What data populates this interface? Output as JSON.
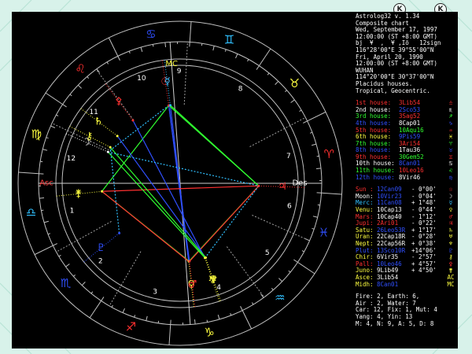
{
  "window": {
    "toolbar_icons": [
      {
        "name": "k-icon",
        "glyph": "K"
      },
      {
        "name": "k-icon",
        "glyph": "K"
      }
    ]
  },
  "info": {
    "lines": [
      "Astrolog32 v. 1.34",
      "Composite chart",
      "Wed, September 17, 1997",
      "12:00:00 (ST +8:00 GMT)",
      "bj  ¥  ,  ¥ ,Iô   12sign",
      "116°28'00\"E 39°55'00\"N",
      "Fri, April 20, 1990",
      "12:00:00 (ST +8:00 GMT)",
      "WUHAN",
      "114°20'00\"E 30°37'00\"N",
      "Placidus houses.",
      "Tropical, Geocentric."
    ]
  },
  "houses": [
    {
      "label": "1st house:",
      "value": "3Lib54",
      "glyph": "♎",
      "label_color": "#ff3030",
      "value_color": "#ff3030",
      "glyph_color": "#ff3030"
    },
    {
      "label": "2nd house:",
      "value": "2Sco53",
      "glyph": "♏",
      "label_color": "#ffffff",
      "value_color": "#3050ff",
      "glyph_color": "#ffffff"
    },
    {
      "label": "3rd house:",
      "value": "3Sag52",
      "glyph": "♐",
      "label_color": "#30ff30",
      "value_color": "#ff3030",
      "glyph_color": "#30ff30"
    },
    {
      "label": "4th house:",
      "value": "8Cap01",
      "glyph": "♑",
      "label_color": "#3050ff",
      "value_color": "#ffffff",
      "glyph_color": "#3050ff"
    },
    {
      "label": "5th house:",
      "value": "10Aqu16",
      "glyph": "♒",
      "label_color": "#ff3030",
      "value_color": "#30ff30",
      "glyph_color": "#ff3030"
    },
    {
      "label": "6th house:",
      "value": "9Pis59",
      "glyph": "♓",
      "label_color": "#ffff40",
      "value_color": "#3050ff",
      "glyph_color": "#ffff40"
    },
    {
      "label": "7th house:",
      "value": "3Ari54",
      "glyph": "♈",
      "label_color": "#30ff30",
      "value_color": "#ff3030",
      "glyph_color": "#30ff30"
    },
    {
      "label": "8th house:",
      "value": "1Tau36",
      "glyph": "♉",
      "label_color": "#3050ff",
      "value_color": "#ffffff",
      "glyph_color": "#3050ff"
    },
    {
      "label": "9th house:",
      "value": "30Gem52",
      "glyph": "♊",
      "label_color": "#ff3030",
      "value_color": "#30ff30",
      "glyph_color": "#ff3030"
    },
    {
      "label": "10th house:",
      "value": "8Can01",
      "glyph": "♋",
      "label_color": "#ffffff",
      "value_color": "#3050ff",
      "glyph_color": "#ffffff"
    },
    {
      "label": "11th house:",
      "value": "10Leo16",
      "glyph": "♌",
      "label_color": "#30ff30",
      "value_color": "#ff3030",
      "glyph_color": "#30ff30"
    },
    {
      "label": "12th house:",
      "value": "8Vir46",
      "glyph": "♍",
      "label_color": "#3050ff",
      "value_color": "#ffffff",
      "glyph_color": "#3050ff"
    }
  ],
  "planets": [
    {
      "label": "Sun :",
      "value": "12Can09",
      "aspect": "- 0°00'",
      "glyph": "☉",
      "label_color": "#ff3030",
      "value_color": "#3050ff",
      "glyph_color": "#ff3030"
    },
    {
      "label": "Moon:",
      "value": "10Vir23",
      "aspect": "- 0°04'",
      "glyph": "☽",
      "label_color": "#ffffff",
      "value_color": "#3050ff",
      "glyph_color": "#ffffff"
    },
    {
      "label": "Merc:",
      "value": "11Can08",
      "aspect": "+ 1°48'",
      "glyph": "☿",
      "label_color": "#30c0ff",
      "value_color": "#3050ff",
      "glyph_color": "#30c0ff"
    },
    {
      "label": "Venu:",
      "value": "10Cap13",
      "aspect": "- 0°44'",
      "glyph": "♀",
      "label_color": "#ffff40",
      "value_color": "#ffffff",
      "glyph_color": "#ffff40"
    },
    {
      "label": "Mars:",
      "value": "10Cap40",
      "aspect": "- 1°12'",
      "glyph": "♂",
      "label_color": "#ff3030",
      "value_color": "#ffffff",
      "glyph_color": "#ff3030"
    },
    {
      "label": "Jupi:",
      "value": "2Ari01",
      "aspect": "- 0°22'",
      "glyph": "♃",
      "label_color": "#ff3030",
      "value_color": "#ff3030",
      "glyph_color": "#ff3030"
    },
    {
      "label": "Satu:",
      "value": "26Leo53R",
      "aspect": "+ 1°17'",
      "glyph": "♄",
      "label_color": "#ffff40",
      "value_color": "#3050ff",
      "glyph_color": "#ffff40"
    },
    {
      "label": "Uran:",
      "value": "22Cap18R",
      "aspect": "- 0°28'",
      "glyph": "♅",
      "label_color": "#ffff40",
      "value_color": "#ffffff",
      "glyph_color": "#ffff40"
    },
    {
      "label": "Nept:",
      "value": "22Cap56R",
      "aspect": "+ 0°38'",
      "glyph": "♆",
      "label_color": "#ffff40",
      "value_color": "#ffffff",
      "glyph_color": "#ffff40"
    },
    {
      "label": "Plut:",
      "value": "13Sco10R",
      "aspect": "+14°06'",
      "glyph": "♇",
      "label_color": "#3050ff",
      "value_color": "#3050ff",
      "glyph_color": "#3050ff"
    },
    {
      "label": "Chir:",
      "value": "6Vir35",
      "aspect": "- 2°57'",
      "glyph": "⚷",
      "label_color": "#ffff40",
      "value_color": "#ffffff",
      "glyph_color": "#ffff40"
    },
    {
      "label": "Pall:",
      "value": "10Leo46",
      "aspect": "+ 4°57'",
      "glyph": "⚴",
      "label_color": "#ff3030",
      "value_color": "#3050ff",
      "glyph_color": "#ff3030"
    },
    {
      "label": "Juno:",
      "value": "9Lib49",
      "aspect": "+ 4°50'",
      "glyph": "⚵",
      "label_color": "#ffff40",
      "value_color": "#ffffff",
      "glyph_color": "#ffff40"
    },
    {
      "label": "Asce:",
      "value": "3Lib54",
      "aspect": "",
      "glyph": "AC",
      "label_color": "#ffff40",
      "value_color": "#ffffff",
      "glyph_color": "#ffff40"
    },
    {
      "label": "Midh:",
      "value": "8Can01",
      "aspect": "",
      "glyph": "MC",
      "label_color": "#ffff40",
      "value_color": "#3050ff",
      "glyph_color": "#ffff40"
    }
  ],
  "elements": {
    "lines": [
      "Fire: 2, Earth: 6,",
      "Air : 2, Water: 7",
      "Car: 12, Fix: 1, Mut: 4",
      "Yang: 4, Yin: 13",
      "M: 4, N: 9, A: 5, D: 8"
    ]
  },
  "wheel": {
    "sign_colors": {
      "fire": "#ff3030",
      "earth": "#ffff40",
      "air": "#30c0ff",
      "water": "#3050ff"
    },
    "signs": [
      {
        "name": "aries-glyph",
        "glyph": "♈",
        "element": "fire"
      },
      {
        "name": "taurus-glyph",
        "glyph": "♉",
        "element": "earth"
      },
      {
        "name": "gemini-glyph",
        "glyph": "♊",
        "element": "air"
      },
      {
        "name": "cancer-glyph",
        "glyph": "♋",
        "element": "water"
      },
      {
        "name": "leo-glyph",
        "glyph": "♌",
        "element": "fire"
      },
      {
        "name": "virgo-glyph",
        "glyph": "♍",
        "element": "earth"
      },
      {
        "name": "libra-glyph",
        "glyph": "♎",
        "element": "air"
      },
      {
        "name": "scorpio-glyph",
        "glyph": "♏",
        "element": "water"
      },
      {
        "name": "sagittarius-glyph",
        "glyph": "♐",
        "element": "fire"
      },
      {
        "name": "capricorn-glyph",
        "glyph": "♑",
        "element": "earth"
      },
      {
        "name": "aquarius-glyph",
        "glyph": "♒",
        "element": "air"
      },
      {
        "name": "pisces-glyph",
        "glyph": "♓",
        "element": "water"
      }
    ],
    "house_cusps_deg": [
      183.9,
      212.9,
      243.9,
      278.0,
      310.3,
      340.0,
      3.9,
      31.6,
      90.9,
      98.0,
      130.3,
      158.8
    ],
    "house_numbers": [
      "1",
      "2",
      "3",
      "4",
      "5",
      "6",
      "7",
      "8",
      "9",
      "10",
      "11",
      "12"
    ],
    "ascendant_label": "Asc",
    "descendant_label": "Des",
    "midheaven_label": "MC",
    "planets": [
      {
        "name": "sun-glyph",
        "glyph": "☉",
        "lon": 102.2,
        "color": "#ff3030"
      },
      {
        "name": "moon-glyph",
        "glyph": "☽",
        "lon": 160.4,
        "color": "#ffffff"
      },
      {
        "name": "mercury-glyph",
        "glyph": "☿",
        "lon": 101.1,
        "color": "#30c0ff"
      },
      {
        "name": "venus-glyph",
        "glyph": "♀",
        "lon": 280.2,
        "color": "#ffff40"
      },
      {
        "name": "mars-glyph",
        "glyph": "♂",
        "lon": 280.7,
        "color": "#ff3030"
      },
      {
        "name": "jupiter-glyph",
        "glyph": "♃",
        "lon": 2.0,
        "color": "#ff3030"
      },
      {
        "name": "saturn-glyph",
        "glyph": "♄",
        "lon": 146.9,
        "color": "#ffff40"
      },
      {
        "name": "uranus-glyph",
        "glyph": "♅",
        "lon": 292.3,
        "color": "#ffff40"
      },
      {
        "name": "neptune-glyph",
        "glyph": "♆",
        "lon": 292.9,
        "color": "#ffff40"
      },
      {
        "name": "pluto-glyph",
        "glyph": "♇",
        "lon": 223.2,
        "color": "#3050ff"
      },
      {
        "name": "chiron-glyph",
        "glyph": "⚷",
        "lon": 156.6,
        "color": "#ffff40"
      },
      {
        "name": "pallas-glyph",
        "glyph": "⚴",
        "lon": 130.8,
        "color": "#ff3030"
      },
      {
        "name": "juno-glyph",
        "glyph": "⚵",
        "lon": 189.8,
        "color": "#ffff40"
      }
    ],
    "aspects": [
      {
        "from": "sun-glyph",
        "to": "venus-glyph",
        "color": "#3050ff"
      },
      {
        "from": "sun-glyph",
        "to": "mars-glyph",
        "color": "#3050ff"
      },
      {
        "from": "mercury-glyph",
        "to": "venus-glyph",
        "color": "#3050ff"
      },
      {
        "from": "sun-glyph",
        "to": "jupiter-glyph",
        "color": "#30ff30"
      },
      {
        "from": "sun-glyph",
        "to": "juno-glyph",
        "color": "#30ff30"
      },
      {
        "from": "mercury-glyph",
        "to": "jupiter-glyph",
        "color": "#30ff30"
      },
      {
        "from": "venus-glyph",
        "to": "jupiter-glyph",
        "color": "#30ff30"
      },
      {
        "from": "mars-glyph",
        "to": "juno-glyph",
        "color": "#30ff30"
      },
      {
        "from": "juno-glyph",
        "to": "venus-glyph",
        "color": "#ff3030"
      },
      {
        "from": "jupiter-glyph",
        "to": "juno-glyph",
        "color": "#ff3030"
      },
      {
        "from": "mars-glyph",
        "to": "jupiter-glyph",
        "color": "#ff3030"
      },
      {
        "from": "saturn-glyph",
        "to": "neptune-glyph",
        "color": "#3050ff"
      },
      {
        "from": "pallas-glyph",
        "to": "uranus-glyph",
        "color": "#3050ff"
      },
      {
        "from": "moon-glyph",
        "to": "uranus-glyph",
        "color": "#30ff30"
      },
      {
        "from": "chiron-glyph",
        "to": "neptune-glyph",
        "color": "#30ff30"
      },
      {
        "from": "moon-glyph",
        "to": "jupiter-glyph",
        "color": "#30c0ff"
      },
      {
        "from": "sun-glyph",
        "to": "moon-glyph",
        "color": "#30c0ff"
      },
      {
        "from": "pluto-glyph",
        "to": "chiron-glyph",
        "color": "#30c0ff"
      },
      {
        "from": "uranus-glyph",
        "to": "jupiter-glyph",
        "color": "#30c0ff"
      }
    ]
  }
}
